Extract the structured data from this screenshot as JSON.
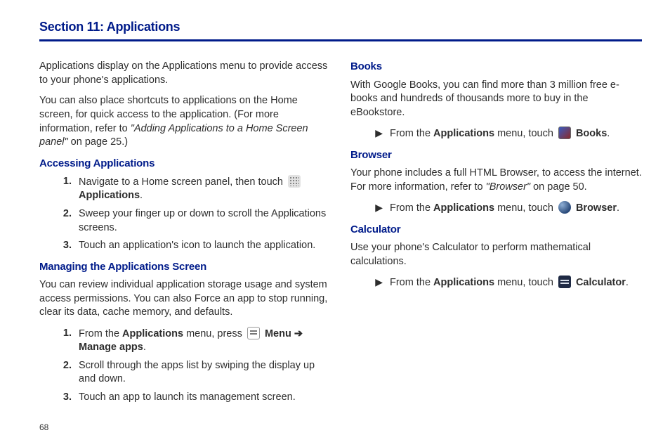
{
  "page_number": "68",
  "section_title": "Section 11: Applications",
  "left": {
    "intro1": "Applications display on the Applications menu to provide access to your phone's applications.",
    "intro2_a": "You can also place shortcuts to applications on the Home screen, for quick access to the application. (For more information, refer to ",
    "intro2_ref": "\"Adding Applications to a Home Screen panel\"",
    "intro2_b": " on page 25.)",
    "h_access": "Accessing Applications",
    "access": {
      "n1": "1.",
      "t1_a": "Navigate to a Home screen panel, then touch ",
      "t1_b": "Applications",
      "t1_c": ".",
      "n2": "2.",
      "t2": "Sweep your finger up or down to scroll the Applications screens.",
      "n3": "3.",
      "t3": "Touch an application's icon to launch the application."
    },
    "h_manage": "Managing the Applications Screen",
    "manage_intro": "You can review individual application storage usage and system access permissions. You can also Force an app to stop running, clear its data, cache memory, and defaults.",
    "manage": {
      "n1": "1.",
      "t1_a": "From the ",
      "t1_b": "Applications",
      "t1_c": " menu, press ",
      "t1_d": "Menu",
      "t1_arrow": " ➔ ",
      "t1_e": "Manage apps",
      "t1_f": ".",
      "n2": "2.",
      "t2": "Scroll through the apps list by swiping the display up and down.",
      "n3": "3.",
      "t3": "Touch an app to launch its management screen."
    }
  },
  "right": {
    "h_books": "Books",
    "books_intro": "With Google Books, you can find more than 3 million free e-books and hundreds of thousands more to buy in the eBookstore.",
    "books_a": "From the ",
    "books_b": "Applications",
    "books_c": " menu, touch ",
    "books_d": "Books",
    "books_e": ".",
    "h_browser": "Browser",
    "browser_intro_a": "Your phone includes a full HTML Browser, to access the internet. For more information, refer to ",
    "browser_ref": "\"Browser\"",
    "browser_intro_b": " on page 50.",
    "browser_a": "From the ",
    "browser_b": "Applications",
    "browser_c": " menu, touch ",
    "browser_d": "Browser",
    "browser_e": ".",
    "h_calc": "Calculator",
    "calc_intro": "Use your phone's Calculator to perform mathematical calculations.",
    "calc_a": "From the ",
    "calc_b": "Applications",
    "calc_c": " menu, touch ",
    "calc_d": "Calculator",
    "calc_e": ".",
    "bullet": "▶"
  }
}
